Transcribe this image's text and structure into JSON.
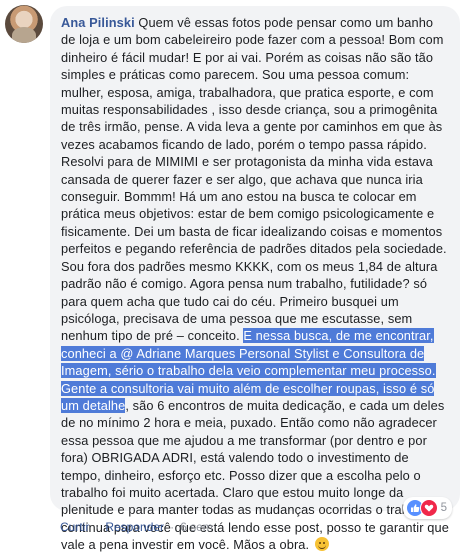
{
  "comment": {
    "author": "Ana Pilinski",
    "text_before_highlight": " Quem vê essas fotos pode pensar como um banho de loja e um bom cabeleireiro pode fazer com a pessoa! Bom com dinheiro é fácil mudar! E por ai vai. Porém as coisas não são tão simples e práticas como parecem. Sou uma pessoa comum: mulher, esposa, amiga, trabalhadora, que pratica esporte, e com muitas responsabilidades , isso desde criança, sou a primogênita de três irmão, pense. A vida leva a gente por caminhos em que às vezes acabamos ficando de lado, porém o tempo passa rápido. Resolvi para de MIMIMI e ser protagonista da minha vida estava cansada de querer fazer e ser algo, que achava que nunca iria conseguir. Bommm! Há um ano estou na busca te colocar em prática meus objetivos: estar de bem comigo psicologicamente e fisicamente. Dei um basta de ficar idealizando coisas e momentos perfeitos e pegando referência de padrões ditados pela sociedade. Sou fora dos padrões mesmo KKKK, com os meus 1,84 de altura padrão não é comigo. Agora pensa num trabalho, futilidade? só para quem acha que tudo cai do céu. Primeiro busquei um psicóloga, precisava de uma pessoa que me escutasse, sem nenhum tipo de pré – conceito. ",
    "highlighted_text": "E nessa busca, de me encontrar, conheci a @ Adriane Marques Personal Stylist e Consultora de Imagem, sério o trabalho dela veio complementar meu processo. Gente a consultoria vai muito além de escolher roupas, isso é só um detalhe",
    "text_after_highlight": ", são 6 encontros de muita dedicação, e cada um deles de no mínimo 2 hora e meia, puxado. Então como não agradecer essa pessoa que me ajudou a me transformar (por dentro e por fora) OBRIGADA ADRI, está valendo todo o investimento de tempo, dinheiro, esforço etc. Posso dizer que a escolha pelo o trabalho foi muito acertada. Claro que estou muito longe da plenitude e para manter todas as mudanças ocorridas o trabalho continua para você que está lendo esse post, posso te garantir que vale a pena investir em você. Mãos a obra. ",
    "emoji_icon": "smiling-face-emoji",
    "highlight_color": "#4f7bd8"
  },
  "reactions": {
    "icons": [
      "like-icon",
      "love-icon"
    ],
    "count": "5"
  },
  "actions": {
    "like_label": "Curtir",
    "separator": "·",
    "reply_label": "Responder",
    "time": "6 sem"
  },
  "colors": {
    "bubble": "#f2f3f5",
    "link": "#385898",
    "like": "#5890ff",
    "love": "#f0284a"
  }
}
